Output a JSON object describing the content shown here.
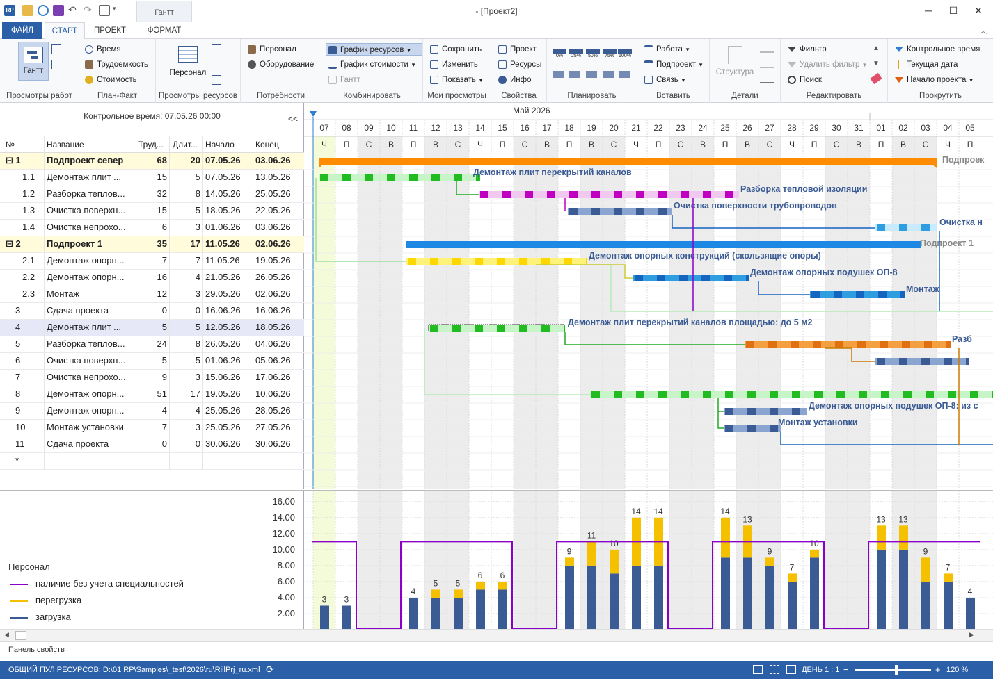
{
  "window": {
    "title": "- [Проект2]",
    "context_tab": "Гантт",
    "app_badge": "RP"
  },
  "tabs": [
    "ФАЙЛ",
    "СТАРТ",
    "ПРОЕКТ",
    "ФОРМАТ"
  ],
  "ribbon": {
    "g1": {
      "label": "Просмотры работ",
      "big": "Гантт"
    },
    "g2": {
      "label": "План-Факт",
      "items": [
        "Время",
        "Трудоемкость",
        "Стоимость"
      ]
    },
    "g3": {
      "label": "Просмотры ресурсов",
      "big": "Персонал"
    },
    "g4": {
      "label": "Потребности",
      "items": [
        "Персонал",
        "Оборудование"
      ]
    },
    "g5": {
      "label": "Комбинировать",
      "items": [
        "График ресурсов",
        "График стоимости",
        "Гантт"
      ]
    },
    "g6": {
      "label": "Мои просмотры",
      "items": [
        "Сохранить",
        "Изменить",
        "Показать"
      ]
    },
    "g7": {
      "label": "Свойства",
      "items": [
        "Проект",
        "Ресурсы",
        "Инфо"
      ]
    },
    "g8": {
      "label": "Планировать",
      "pcts": [
        "0%",
        "25%",
        "50%",
        "75%",
        "100%"
      ]
    },
    "g9": {
      "label": "Вставить",
      "items": [
        "Работа",
        "Подпроект",
        "Связь"
      ]
    },
    "g10": {
      "label": "Детали",
      "big": "Структура"
    },
    "g11": {
      "label": "Редактировать",
      "items": [
        "Фильтр",
        "Удалить фильтр",
        "Поиск"
      ]
    },
    "g12": {
      "label": "Прокрутить",
      "items": [
        "Контрольное время",
        "Текущая дата",
        "Начало проекта"
      ]
    }
  },
  "control_time": "Контрольное время: 07.05.26 00:00",
  "collapse_label": "<<",
  "columns": [
    "№",
    "Название",
    "Труд...",
    "Длит...",
    "Начало",
    "Конец"
  ],
  "rows": [
    {
      "num": "1",
      "name": "Подпроект север",
      "work": "68",
      "dur": "20",
      "start": "07.05.26",
      "end": "03.06.26",
      "summary": true
    },
    {
      "num": "1.1",
      "name": "Демонтаж  плит ...",
      "work": "15",
      "dur": "5",
      "start": "07.05.26",
      "end": "13.05.26"
    },
    {
      "num": "1.2",
      "name": "Разборка теплов...",
      "work": "32",
      "dur": "8",
      "start": "14.05.26",
      "end": "25.05.26"
    },
    {
      "num": "1.3",
      "name": "Очистка поверхн...",
      "work": "15",
      "dur": "5",
      "start": "18.05.26",
      "end": "22.05.26"
    },
    {
      "num": "1.4",
      "name": "Очистка непрохо...",
      "work": "6",
      "dur": "3",
      "start": "01.06.26",
      "end": "03.06.26"
    },
    {
      "num": "2",
      "name": "Подпроект 1",
      "work": "35",
      "dur": "17",
      "start": "11.05.26",
      "end": "02.06.26",
      "summary": true
    },
    {
      "num": "2.1",
      "name": "Демонтаж опорн...",
      "work": "7",
      "dur": "7",
      "start": "11.05.26",
      "end": "19.05.26"
    },
    {
      "num": "2.2",
      "name": "Демонтаж опорн...",
      "work": "16",
      "dur": "4",
      "start": "21.05.26",
      "end": "26.05.26"
    },
    {
      "num": "2.3",
      "name": "Монтаж",
      "work": "12",
      "dur": "3",
      "start": "29.05.26",
      "end": "02.06.26"
    },
    {
      "num": "3",
      "name": "Сдача проекта",
      "work": "0",
      "dur": "0",
      "start": "16.06.26",
      "end": "16.06.26"
    },
    {
      "num": "4",
      "name": "Демонтаж  плит ...",
      "work": "5",
      "dur": "5",
      "start": "12.05.26",
      "end": "18.05.26",
      "selected": true
    },
    {
      "num": "5",
      "name": "Разборка теплов...",
      "work": "24",
      "dur": "8",
      "start": "26.05.26",
      "end": "04.06.26"
    },
    {
      "num": "6",
      "name": "Очистка поверхн...",
      "work": "5",
      "dur": "5",
      "start": "01.06.26",
      "end": "05.06.26"
    },
    {
      "num": "7",
      "name": "Очистка непрохо...",
      "work": "9",
      "dur": "3",
      "start": "15.06.26",
      "end": "17.06.26"
    },
    {
      "num": "8",
      "name": "Демонтаж опорн...",
      "work": "51",
      "dur": "17",
      "start": "19.05.26",
      "end": "10.06.26"
    },
    {
      "num": "9",
      "name": "Демонтаж опорн...",
      "work": "4",
      "dur": "4",
      "start": "25.05.26",
      "end": "28.05.26"
    },
    {
      "num": "10",
      "name": "Монтаж установки",
      "work": "7",
      "dur": "3",
      "start": "25.05.26",
      "end": "27.05.26"
    },
    {
      "num": "11",
      "name": "Сдача проекта",
      "work": "0",
      "dur": "0",
      "start": "30.06.26",
      "end": "30.06.26"
    },
    {
      "num": "*",
      "name": "",
      "work": "",
      "dur": "",
      "start": "",
      "end": ""
    }
  ],
  "timeline": {
    "month_label": "Май 2026",
    "days": [
      "07",
      "08",
      "09",
      "10",
      "11",
      "12",
      "13",
      "14",
      "15",
      "16",
      "17",
      "18",
      "19",
      "20",
      "21",
      "22",
      "23",
      "24",
      "25",
      "26",
      "27",
      "28",
      "29",
      "30",
      "31",
      "01",
      "02",
      "03",
      "04",
      "05"
    ],
    "weekdays": [
      "Ч",
      "П",
      "С",
      "В",
      "П",
      "В",
      "С",
      "Ч",
      "П",
      "С",
      "В",
      "П",
      "В",
      "С",
      "Ч",
      "П",
      "С",
      "В",
      "П",
      "В",
      "С",
      "Ч",
      "П",
      "С",
      "В",
      "П",
      "В",
      "С",
      "Ч",
      "П"
    ]
  },
  "bar_labels": {
    "b1_1": "Демонтаж  плит перекрытий каналов",
    "b1_2": "Разборка тепловой изоляции",
    "b1_3": "Очистка поверхности трубопроводов",
    "b1_4": "Очистка н",
    "b1": "Подпроек",
    "b2": "Подпроект 1",
    "b2_1": "Демонтаж опорных конструкций (скользящие опоры)",
    "b2_2": "Демонтаж опорных подушек ОП-8",
    "b2_3": "Монтаж",
    "b4": "Демонтаж  плит перекрытий каналов площадью:  до 5 м2",
    "b5": "Разб",
    "b9": "Демонтаж опорных подушек ОП-8: из с",
    "b10": "Монтаж установки"
  },
  "colors": {
    "accent": "#2b5fa8",
    "summary": "#ff8c00",
    "subproject": "#1e88e5",
    "green": "#22bb22",
    "purple": "#c000c0",
    "navy": "#3b5b94",
    "yellow": "#ffd700",
    "overload": "#f5c000",
    "availability": "#8a00c8"
  },
  "histogram": {
    "title": "Персонал",
    "legend": [
      "наличие без учета специальностей",
      "перегрузка",
      "загрузка"
    ],
    "y_ticks": [
      "16.00",
      "14.00",
      "12.00",
      "10.00",
      "8.00",
      "6.00",
      "4.00",
      "2.00"
    ],
    "ylim": [
      0,
      16.5
    ],
    "chart_data": {
      "type": "bar",
      "categories": [
        "07",
        "08",
        "09",
        "10",
        "11",
        "12",
        "13",
        "14",
        "15",
        "16",
        "17",
        "18",
        "19",
        "20",
        "21",
        "22",
        "23",
        "24",
        "25",
        "26",
        "27",
        "28",
        "29",
        "30",
        "31",
        "01",
        "02",
        "03",
        "04",
        "05"
      ],
      "series": [
        {
          "name": "загрузка",
          "values": [
            3,
            3,
            0,
            0,
            4,
            4,
            4,
            5,
            5,
            0,
            0,
            8,
            8,
            7,
            8,
            8,
            0,
            0,
            9,
            9,
            8,
            6,
            9,
            0,
            0,
            10,
            10,
            6,
            6,
            4
          ]
        },
        {
          "name": "перегрузка",
          "values": [
            0,
            0,
            0,
            0,
            0,
            1,
            1,
            1,
            1,
            0,
            0,
            1,
            3,
            3,
            6,
            6,
            0,
            0,
            5,
            4,
            1,
            1,
            1,
            0,
            0,
            3,
            3,
            3,
            1,
            0
          ]
        },
        {
          "name": "наличие без учета специальностей",
          "values": [
            11,
            11,
            0,
            0,
            11,
            11,
            11,
            11,
            11,
            0,
            0,
            11,
            11,
            11,
            11,
            11,
            0,
            0,
            11,
            11,
            11,
            11,
            11,
            0,
            0,
            11,
            11,
            11,
            11,
            11
          ]
        }
      ],
      "labels": [
        "3",
        "3",
        "",
        "",
        "4",
        "5",
        "5",
        "6",
        "6",
        "",
        "",
        "9",
        "11",
        "10",
        "14",
        "14",
        "",
        "",
        "14",
        "13",
        "9",
        "7",
        "10",
        "",
        "",
        "13",
        "13",
        "9",
        "7",
        "4"
      ]
    }
  },
  "props_label": "Панель свойств",
  "status": {
    "left": "ОБЩИЙ ПУЛ РЕСУРСОВ: D:\\01 RP\\Samples\\_test\\2026\\ru\\RillPrj_ru.xml",
    "scale": "ДЕНЬ 1 : 1",
    "zoom": "120 %"
  }
}
